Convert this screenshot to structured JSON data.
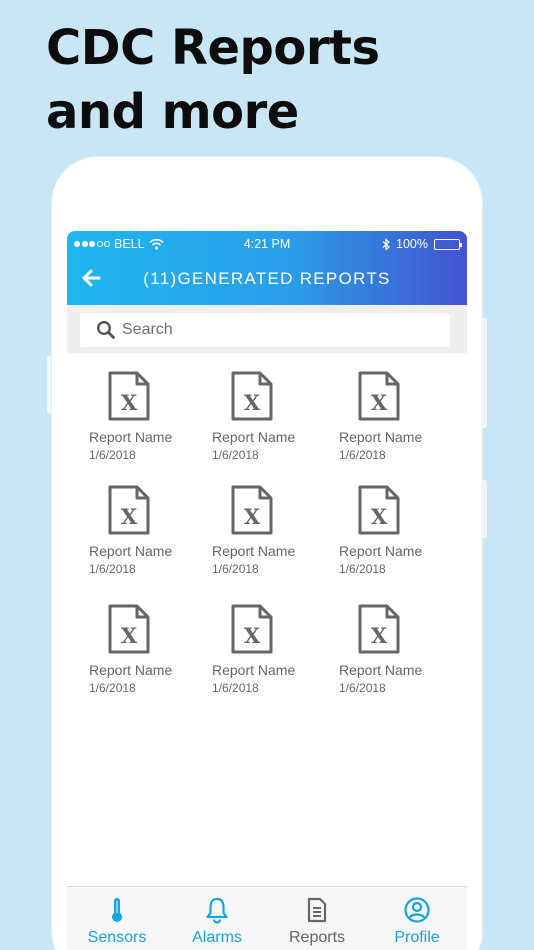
{
  "headline": {
    "line1": "CDC Reports",
    "line2": "and more"
  },
  "status_bar": {
    "carrier": "BELL",
    "time": "4:21 PM",
    "battery": "100%"
  },
  "header": {
    "title": "(11)GENERATED REPORTS"
  },
  "search": {
    "placeholder": "Search",
    "value": ""
  },
  "reports": [
    {
      "name": "Report Name",
      "date": "1/6/2018"
    },
    {
      "name": "Report Name",
      "date": "1/6/2018"
    },
    {
      "name": "Report Name",
      "date": "1/6/2018"
    },
    {
      "name": "Report Name",
      "date": "1/6/2018"
    },
    {
      "name": "Report Name",
      "date": "1/6/2018"
    },
    {
      "name": "Report Name",
      "date": "1/6/2018"
    },
    {
      "name": "Report Name",
      "date": "1/6/2018"
    },
    {
      "name": "Report Name",
      "date": "1/6/2018"
    },
    {
      "name": "Report Name",
      "date": "1/6/2018"
    }
  ],
  "tabs": [
    {
      "label": "Sensors",
      "icon": "thermometer-icon",
      "active": true
    },
    {
      "label": "Alarms",
      "icon": "bell-icon",
      "active": true
    },
    {
      "label": "Reports",
      "icon": "document-icon",
      "active": false
    },
    {
      "label": "Profile",
      "icon": "user-circle-icon",
      "active": true
    }
  ],
  "colors": {
    "background": "#c9e6f6",
    "header_start": "#1fb6ee",
    "header_end": "#4452d0",
    "tab_active": "#16a3e2",
    "tab_inactive": "#666666",
    "file_icon": "#666666"
  }
}
